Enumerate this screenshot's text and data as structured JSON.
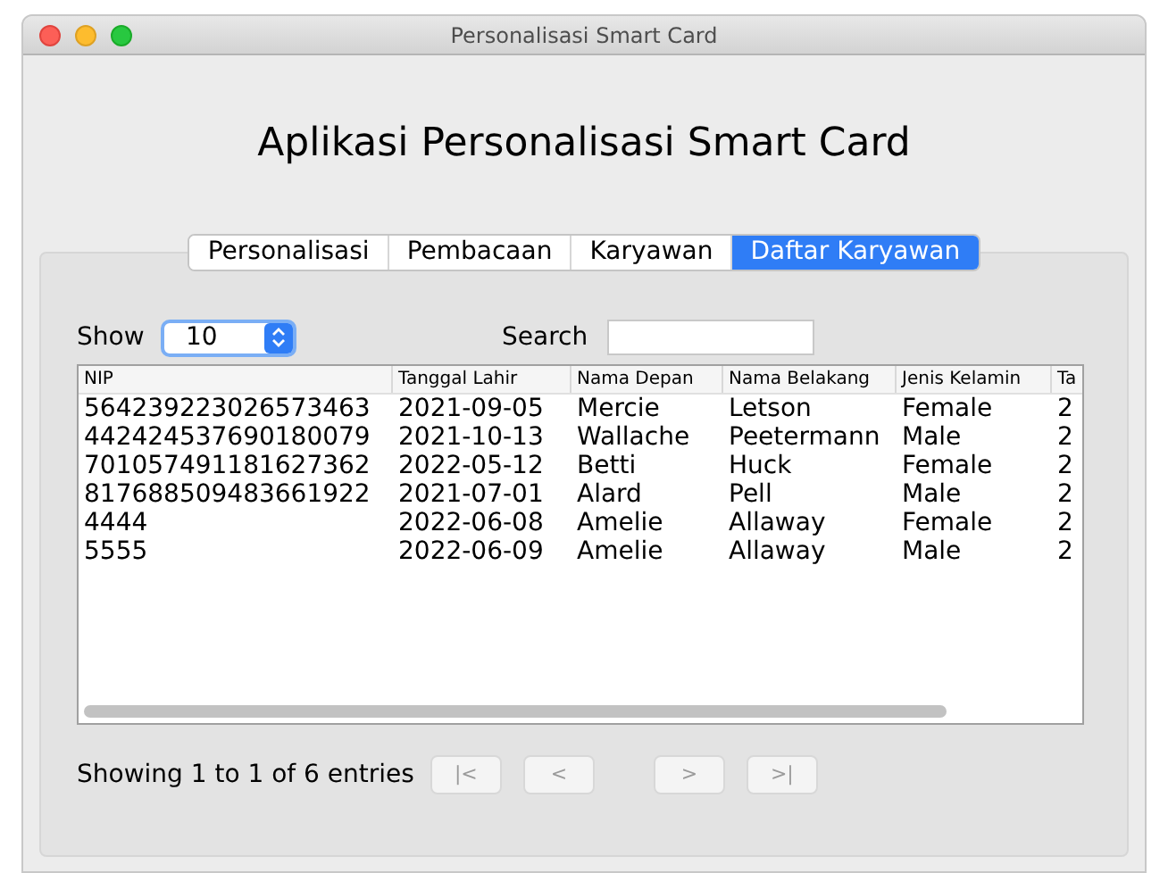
{
  "window": {
    "title": "Personalisasi Smart Card"
  },
  "heading": "Aplikasi Personalisasi Smart Card",
  "tabs": [
    {
      "label": "Personalisasi",
      "selected": false
    },
    {
      "label": "Pembacaan",
      "selected": false
    },
    {
      "label": "Karyawan",
      "selected": false
    },
    {
      "label": "Daftar Karyawan",
      "selected": true
    }
  ],
  "show": {
    "label": "Show",
    "value": "10"
  },
  "search": {
    "label": "Search"
  },
  "table": {
    "columns": [
      "NIP",
      "Tanggal Lahir",
      "Nama Depan",
      "Nama Belakang",
      "Jenis Kelamin",
      "Ta"
    ],
    "rows": [
      [
        "564239223026573463",
        "2021-09-05",
        "Mercie",
        "Letson",
        "Female",
        "2"
      ],
      [
        "442424537690180079",
        "2021-10-13",
        "Wallache",
        "Peetermann",
        "Male",
        "2"
      ],
      [
        "701057491181627362",
        "2022-05-12",
        "Betti",
        "Huck",
        "Female",
        "2"
      ],
      [
        "817688509483661922",
        "2021-07-01",
        "Alard",
        "Pell",
        "Male",
        "2"
      ],
      [
        "4444",
        "2022-06-08",
        "Amelie",
        "Allaway",
        "Female",
        "2"
      ],
      [
        "5555",
        "2022-06-09",
        "Amelie",
        "Allaway",
        "Male",
        "2"
      ]
    ]
  },
  "status": "Showing 1 to 1 of 6 entries",
  "pager": [
    {
      "label": "|<",
      "disabled": true
    },
    {
      "label": "<",
      "disabled": true
    },
    {
      "label": ">",
      "disabled": true
    },
    {
      "label": ">|",
      "disabled": true
    }
  ]
}
